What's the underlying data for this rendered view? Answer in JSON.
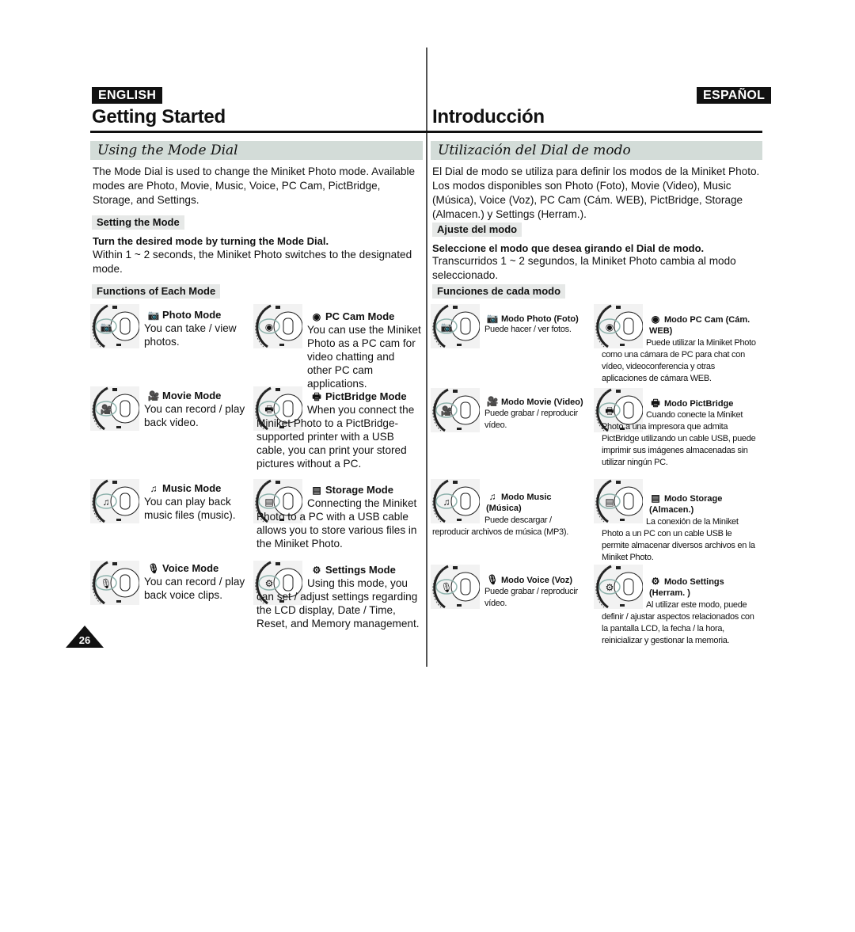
{
  "english": {
    "lang_tag": "ENGLISH",
    "page_title": "Getting Started",
    "section_title": "Using the Mode Dial",
    "intro": "The Mode Dial is used to change the Miniket Photo mode. Available modes are Photo, Movie, Music, Voice, PC Cam, PictBridge, Storage, and Settings.",
    "setting_heading": "Setting the Mode",
    "setting_instruction": "Turn the desired mode by turning the Mode Dial.",
    "setting_note": "Within 1 ~ 2 seconds, the Miniket Photo switches to the designated mode.",
    "functions_heading": "Functions of Each Mode",
    "modes": [
      {
        "icon": "camera-icon",
        "glyph": "📷",
        "title": "Photo Mode",
        "text": "You can take / view photos."
      },
      {
        "icon": "pc-cam-icon",
        "glyph": "◉",
        "title": "PC Cam Mode",
        "text": "You can use the Miniket Photo as a PC cam for video chatting and other PC cam applications."
      },
      {
        "icon": "movie-camera-icon",
        "glyph": "🎥",
        "title": "Movie Mode",
        "text": "You can record / play back video."
      },
      {
        "icon": "printer-icon",
        "glyph": "🖶",
        "title": "PictBridge Mode",
        "text": "When you connect the Miniket Photo to a PictBridge-supported printer with a USB cable, you can print your stored pictures without a PC."
      },
      {
        "icon": "music-note-icon",
        "glyph": "♫",
        "title": "Music Mode",
        "text": "You can play back music files (music)."
      },
      {
        "icon": "storage-icon",
        "glyph": "▤",
        "title": "Storage Mode",
        "text": "Connecting the Miniket Photo to a PC with a USB cable allows you to store various files in the Miniket Photo."
      },
      {
        "icon": "microphone-icon",
        "glyph": "🎙",
        "title": "Voice Mode",
        "text": "You can record / play back voice clips."
      },
      {
        "icon": "gear-icon",
        "glyph": "⚙",
        "title": "Settings Mode",
        "text": "Using this mode, you can set / adjust settings regarding the LCD display, Date / Time, Reset, and Memory management."
      }
    ]
  },
  "spanish": {
    "lang_tag": "ESPAÑOL",
    "page_title": "Introducción",
    "section_title": "Utilización del Dial de modo",
    "intro": "El Dial de modo se utiliza para definir los modos de la Miniket Photo. Los modos disponibles son Photo (Foto), Movie (Video), Music (Música), Voice (Voz), PC Cam (Cám. WEB), PictBridge, Storage (Almacen.) y Settings (Herram.).",
    "setting_heading": "Ajuste del modo",
    "setting_instruction": "Seleccione el modo que desea girando el Dial de modo.",
    "setting_note": "Transcurridos 1 ~ 2 segundos, la Miniket Photo cambia al modo seleccionado.",
    "functions_heading": "Funciones de cada modo",
    "modes": [
      {
        "icon": "camera-icon",
        "glyph": "📷",
        "title": "Modo Photo (Foto)",
        "text": "Puede hacer / ver fotos."
      },
      {
        "icon": "pc-cam-icon",
        "glyph": "◉",
        "title": "Modo PC Cam (Cám. WEB)",
        "text": "Puede utilizar la Miniket Photo como una cámara de PC para chat con vídeo, videoconferencia y otras aplicaciones de cámara WEB."
      },
      {
        "icon": "movie-camera-icon",
        "glyph": "🎥",
        "title": "Modo Movie (Video)",
        "text": "Puede grabar / reproducir vídeo."
      },
      {
        "icon": "printer-icon",
        "glyph": "🖶",
        "title": "Modo PictBridge",
        "text": "Cuando conecte la Miniket Photo a una impresora que admita PictBridge utilizando un cable USB, puede imprimir sus imágenes almacenadas sin utilizar ningún PC."
      },
      {
        "icon": "music-note-icon",
        "glyph": "♫",
        "title": "Modo Music (Música)",
        "text": "Puede descargar / reproducir archivos de música (MP3)."
      },
      {
        "icon": "storage-icon",
        "glyph": "▤",
        "title": "Modo Storage (Almacen.)",
        "text": "La conexión de la Miniket Photo a un PC con un cable USB le permite almacenar diversos archivos en la Miniket Photo."
      },
      {
        "icon": "microphone-icon",
        "glyph": "🎙",
        "title": "Modo Voice (Voz)",
        "text": "Puede grabar / reproducir vídeo."
      },
      {
        "icon": "gear-icon",
        "glyph": "⚙",
        "title": "Modo Settings (Herram. )",
        "text": "Al utilizar este modo, puede definir / ajustar aspectos relacionados con la pantalla LCD, la fecha / la hora, reinicializar y gestionar la memoria."
      }
    ]
  },
  "page_number": "26",
  "colors": {
    "section_bar": "#d3dcd8",
    "sub_bar": "#e6e8e7",
    "dial_highlight": "#8fb3ad",
    "ink": "#111111"
  }
}
